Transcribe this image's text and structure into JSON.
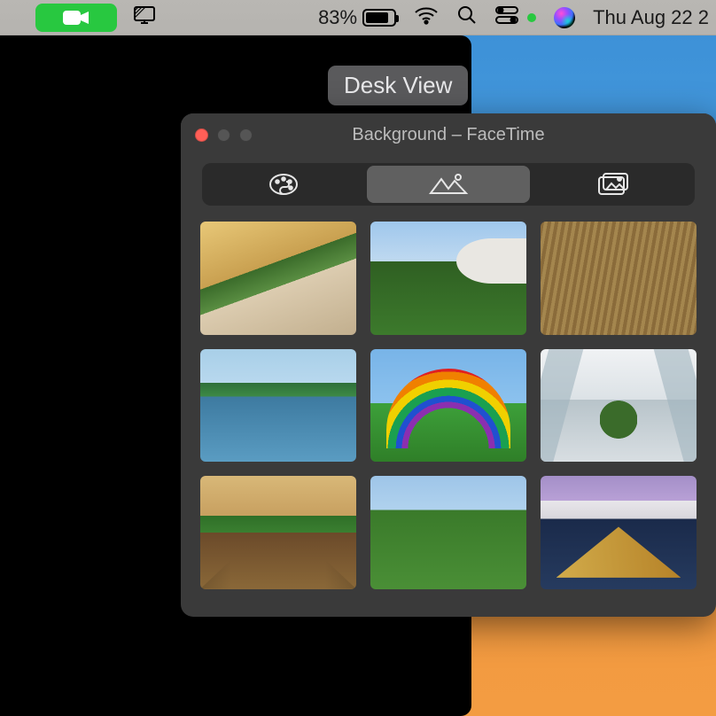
{
  "menubar": {
    "battery_percent": "83%",
    "date_time": "Thu Aug 22  2",
    "icons": {
      "camera_active": "camera-icon",
      "screen_share": "screenshare-icon",
      "wifi": "wifi-icon",
      "search": "search-icon",
      "control_center": "control-center-icon",
      "siri": "siri-icon"
    }
  },
  "desk_view_button": {
    "label": "Desk View"
  },
  "background_window": {
    "title": "Background – FaceTime",
    "segments": [
      {
        "name": "color-fill",
        "selected": false,
        "icon": "palette-icon"
      },
      {
        "name": "scenic",
        "selected": true,
        "icon": "landscape-icon"
      },
      {
        "name": "photo-library",
        "selected": false,
        "icon": "photos-icon"
      }
    ],
    "thumbnails": [
      {
        "name": "apple-park-spiral",
        "row": 1,
        "col": 1
      },
      {
        "name": "apple-park-ring",
        "row": 1,
        "col": 2
      },
      {
        "name": "wood-slats",
        "row": 1,
        "col": 3
      },
      {
        "name": "pond-trees",
        "row": 2,
        "col": 1
      },
      {
        "name": "rainbow-stage",
        "row": 2,
        "col": 2
      },
      {
        "name": "light-atrium",
        "row": 2,
        "col": 3
      },
      {
        "name": "wooden-walkway",
        "row": 3,
        "col": 1
      },
      {
        "name": "garden-path",
        "row": 3,
        "col": 2
      },
      {
        "name": "steve-jobs-theater-dusk",
        "row": 3,
        "col": 3
      }
    ]
  }
}
